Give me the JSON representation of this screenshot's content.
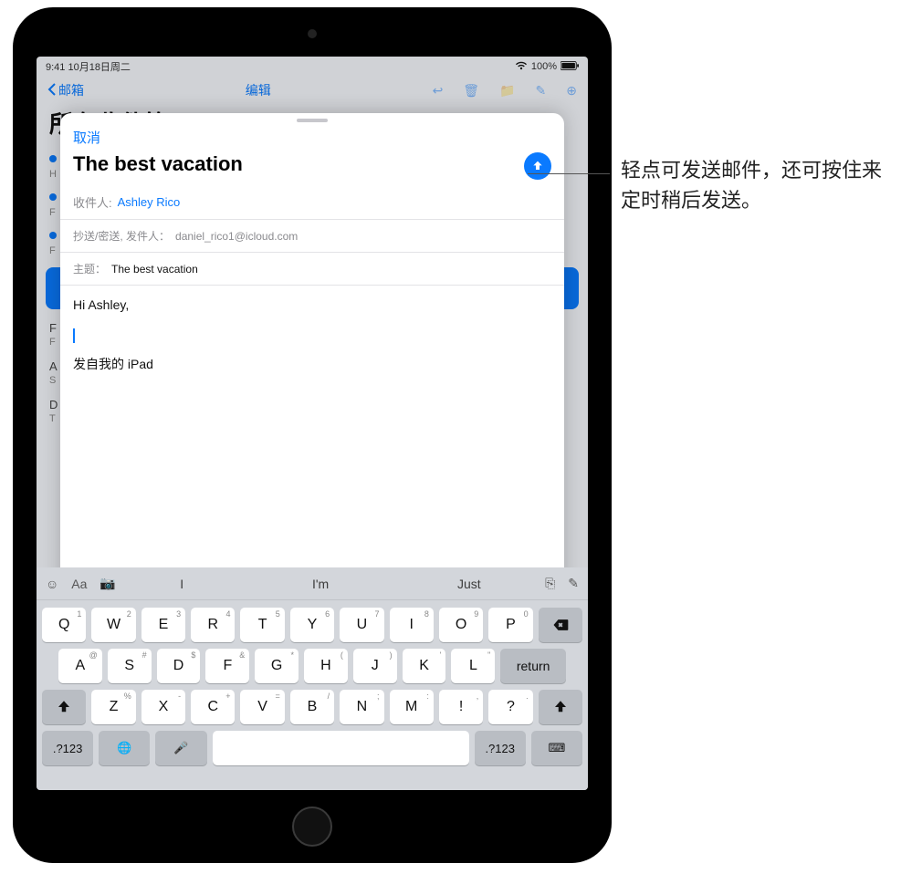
{
  "statusbar": {
    "time": "9:41 10月18日周二",
    "battery": "100%"
  },
  "bg": {
    "back": "邮箱",
    "edit": "编辑",
    "title": "所有收件箱"
  },
  "compose": {
    "cancel": "取消",
    "title": "The best vacation",
    "to_label": "收件人:",
    "to_value": "Ashley Rico",
    "cc_label": "抄送/密送, 发件人：",
    "cc_value": "daniel_rico1@icloud.com",
    "subject_label": "主题：",
    "subject_value": "The best vacation",
    "body_greeting": "Hi Ashley,",
    "signature": "发自我的 iPad"
  },
  "keyboard": {
    "suggestions": [
      "I",
      "I'm",
      "Just"
    ],
    "row1": [
      {
        "k": "Q",
        "s": "1"
      },
      {
        "k": "W",
        "s": "2"
      },
      {
        "k": "E",
        "s": "3"
      },
      {
        "k": "R",
        "s": "4"
      },
      {
        "k": "T",
        "s": "5"
      },
      {
        "k": "Y",
        "s": "6"
      },
      {
        "k": "U",
        "s": "7"
      },
      {
        "k": "I",
        "s": "8"
      },
      {
        "k": "O",
        "s": "9"
      },
      {
        "k": "P",
        "s": "0"
      }
    ],
    "row2": [
      {
        "k": "A",
        "s": "@"
      },
      {
        "k": "S",
        "s": "#"
      },
      {
        "k": "D",
        "s": "$"
      },
      {
        "k": "F",
        "s": "&"
      },
      {
        "k": "G",
        "s": "*"
      },
      {
        "k": "H",
        "s": "("
      },
      {
        "k": "J",
        "s": ")"
      },
      {
        "k": "K",
        "s": "'"
      },
      {
        "k": "L",
        "s": "\""
      }
    ],
    "row3": [
      {
        "k": "Z",
        "s": "%"
      },
      {
        "k": "X",
        "s": "-"
      },
      {
        "k": "C",
        "s": "+"
      },
      {
        "k": "V",
        "s": "="
      },
      {
        "k": "B",
        "s": "/"
      },
      {
        "k": "N",
        "s": ";"
      },
      {
        "k": "M",
        "s": ":"
      },
      {
        "k": "!",
        "s": ","
      },
      {
        "k": "?",
        "s": "."
      }
    ],
    "numkey": ".?123",
    "return": "return"
  },
  "callout": "轻点可发送邮件，还可按住来定时稍后发送。"
}
